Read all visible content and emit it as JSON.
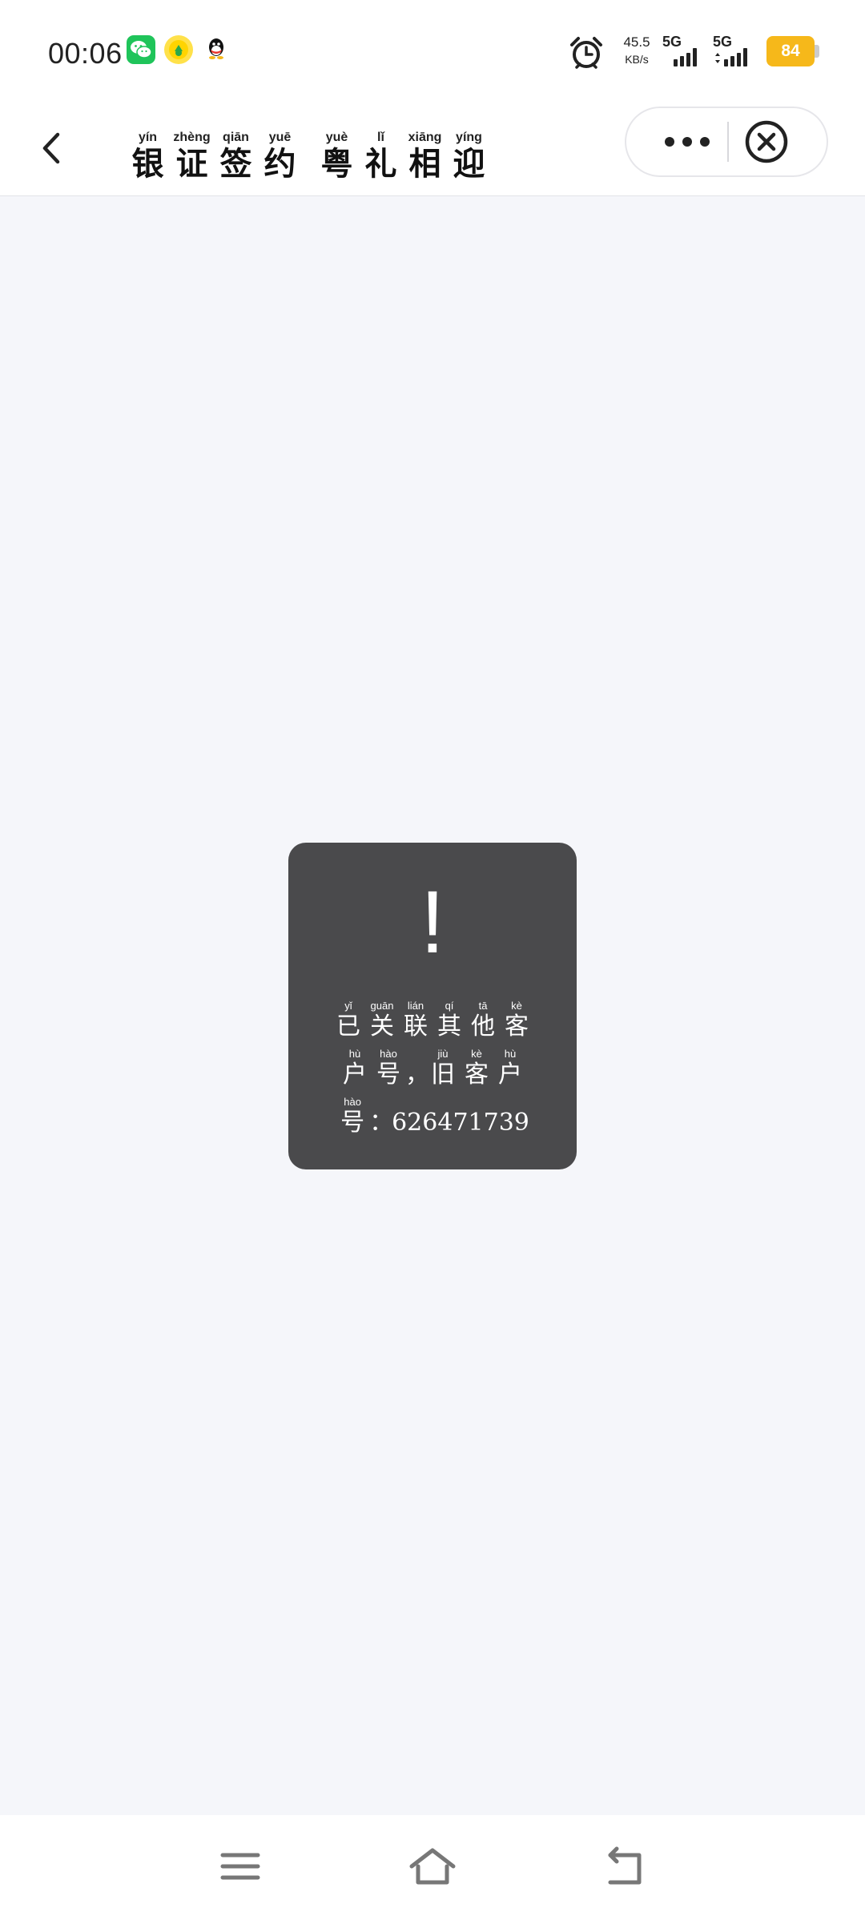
{
  "status_bar": {
    "time": "00:06",
    "net_speed_value": "45.5",
    "net_speed_unit": "KB/s",
    "signal1_label": "5G",
    "signal2_label": "5G",
    "battery_level": "84",
    "notification_icons": [
      "wechat-icon",
      "music-app-icon",
      "qq-icon"
    ],
    "colors": {
      "battery": "#f6b81a",
      "wechat": "#1fc45a"
    }
  },
  "navbar": {
    "title_chars": [
      {
        "pinyin": "yín",
        "char": "银"
      },
      {
        "pinyin": "zhèng",
        "char": "证"
      },
      {
        "pinyin": "qiān",
        "char": "签"
      },
      {
        "pinyin": "yuē",
        "char": "约"
      },
      {
        "pinyin": "yuè",
        "char": "粤"
      },
      {
        "pinyin": "lǐ",
        "char": "礼"
      },
      {
        "pinyin": "xiāng",
        "char": "相"
      },
      {
        "pinyin": "yíng",
        "char": "迎"
      }
    ]
  },
  "toast": {
    "icon": "!",
    "line1": [
      {
        "pinyin": "yǐ",
        "char": "已"
      },
      {
        "pinyin": "guān",
        "char": "关"
      },
      {
        "pinyin": "lián",
        "char": "联"
      },
      {
        "pinyin": "qí",
        "char": "其"
      },
      {
        "pinyin": "tā",
        "char": "他"
      },
      {
        "pinyin": "kè",
        "char": "客"
      }
    ],
    "line2": [
      {
        "pinyin": "hù",
        "char": "户"
      },
      {
        "pinyin": "hào",
        "char": "号"
      },
      {
        "pinyin": "",
        "char": "，"
      },
      {
        "pinyin": "jiù",
        "char": "旧"
      },
      {
        "pinyin": "kè",
        "char": "客"
      },
      {
        "pinyin": "hù",
        "char": "户"
      }
    ],
    "line3": [
      {
        "pinyin": "hào",
        "char": "号"
      },
      {
        "pinyin": "",
        "char": "："
      }
    ],
    "account_number": "626471739",
    "background": "#4a4a4c"
  }
}
